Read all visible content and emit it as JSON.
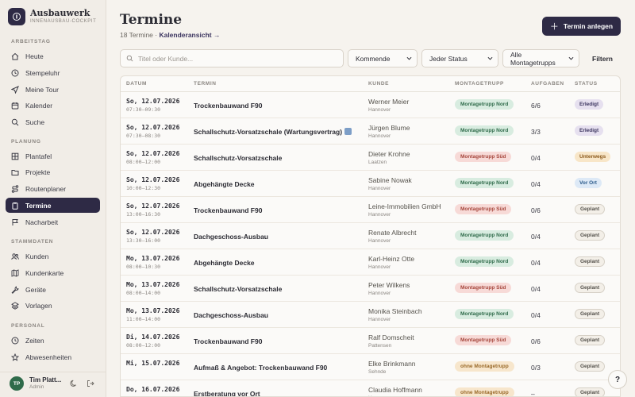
{
  "brand": {
    "name": "Ausbauwerk",
    "subtitle": "INNENAUSBAU-COCKPIT"
  },
  "sidebar": {
    "sections": [
      {
        "label": "ARBEITSTAG"
      },
      {
        "label": "PLANUNG"
      },
      {
        "label": "STAMMDATEN"
      },
      {
        "label": "PERSONAL"
      }
    ],
    "items": [
      {
        "label": "Heute",
        "icon": "home-icon"
      },
      {
        "label": "Stempeluhr",
        "icon": "clock-icon"
      },
      {
        "label": "Meine Tour",
        "icon": "navigation-icon"
      },
      {
        "label": "Kalender",
        "icon": "calendar-icon"
      },
      {
        "label": "Suche",
        "icon": "search-icon"
      },
      {
        "label": "Plantafel",
        "icon": "grid-icon"
      },
      {
        "label": "Projekte",
        "icon": "folder-icon"
      },
      {
        "label": "Routenplaner",
        "icon": "route-icon"
      },
      {
        "label": "Termine",
        "icon": "clipboard-icon",
        "active": true
      },
      {
        "label": "Nacharbeit",
        "icon": "flag-icon"
      },
      {
        "label": "Kunden",
        "icon": "users-icon"
      },
      {
        "label": "Kundenkarte",
        "icon": "map-icon"
      },
      {
        "label": "Geräte",
        "icon": "wrench-icon"
      },
      {
        "label": "Vorlagen",
        "icon": "layers-icon"
      },
      {
        "label": "Zeiten",
        "icon": "clock-icon"
      },
      {
        "label": "Abwesenheiten",
        "icon": "star-icon"
      }
    ],
    "user": {
      "initials": "TP",
      "name": "Tim Platt...",
      "role": "Admin"
    }
  },
  "header": {
    "title": "Termine",
    "count_text": "18 Termine · ",
    "calendar_link": "Kalenderansicht →",
    "new_button": "Termin anlegen"
  },
  "filters": {
    "search_placeholder": "Titel oder Kunde...",
    "period": "Kommende",
    "status": "Jeder Status",
    "team": "Alle Montagetrupps",
    "filter_button": "Filtern"
  },
  "table": {
    "columns": [
      "DATUM",
      "TERMIN",
      "KUNDE",
      "MONTAGETRUPP",
      "AUFGABEN",
      "STATUS"
    ],
    "rows": [
      {
        "date": "So, 12.07.2026",
        "time": "07:30–09:30",
        "title": "Trockenbauwand F90",
        "customer": "Werner Meier",
        "city": "Hannover",
        "team": "Montagetrupp Nord",
        "team_kind": "nord",
        "tasks": "6/6",
        "status": "Erledigt",
        "status_kind": "erledigt"
      },
      {
        "date": "So, 12.07.2026",
        "time": "07:30–08:30",
        "title": "Schallschutz-Vorsatzschale (Wartungsvertrag)",
        "contract_icon": true,
        "customer": "Jürgen Blume",
        "city": "Hannover",
        "team": "Montagetrupp Nord",
        "team_kind": "nord",
        "tasks": "3/3",
        "status": "Erledigt",
        "status_kind": "erledigt"
      },
      {
        "date": "So, 12.07.2026",
        "time": "08:00–12:00",
        "title": "Schallschutz-Vorsatzschale",
        "customer": "Dieter Krohne",
        "city": "Laatzen",
        "team": "Montagetrupp Süd",
        "team_kind": "sued",
        "tasks": "0/4",
        "status": "Unterwegs",
        "status_kind": "unterwegs"
      },
      {
        "date": "So, 12.07.2026",
        "time": "10:00–12:30",
        "title": "Abgehängte Decke",
        "customer": "Sabine Nowak",
        "city": "Hannover",
        "team": "Montagetrupp Nord",
        "team_kind": "nord",
        "tasks": "0/4",
        "status": "Vor Ort",
        "status_kind": "vorort"
      },
      {
        "date": "So, 12.07.2026",
        "time": "13:00–16:30",
        "title": "Trockenbauwand F90",
        "customer": "Leine-Immobilien GmbH",
        "city": "Hannover",
        "team": "Montagetrupp Süd",
        "team_kind": "sued",
        "tasks": "0/6",
        "status": "Geplant",
        "status_kind": "geplant"
      },
      {
        "date": "So, 12.07.2026",
        "time": "13:30–16:00",
        "title": "Dachgeschoss-Ausbau",
        "customer": "Renate Albrecht",
        "city": "Hannover",
        "team": "Montagetrupp Nord",
        "team_kind": "nord",
        "tasks": "0/4",
        "status": "Geplant",
        "status_kind": "geplant"
      },
      {
        "date": "Mo, 13.07.2026",
        "time": "08:00–10:30",
        "title": "Abgehängte Decke",
        "customer": "Karl-Heinz Otte",
        "city": "Hannover",
        "team": "Montagetrupp Nord",
        "team_kind": "nord",
        "tasks": "0/4",
        "status": "Geplant",
        "status_kind": "geplant"
      },
      {
        "date": "Mo, 13.07.2026",
        "time": "08:00–14:00",
        "title": "Schallschutz-Vorsatzschale",
        "customer": "Peter Wilkens",
        "city": "Hannover",
        "team": "Montagetrupp Süd",
        "team_kind": "sued",
        "tasks": "0/4",
        "status": "Geplant",
        "status_kind": "geplant"
      },
      {
        "date": "Mo, 13.07.2026",
        "time": "11:00–14:00",
        "title": "Dachgeschoss-Ausbau",
        "customer": "Monika Steinbach",
        "city": "Hannover",
        "team": "Montagetrupp Nord",
        "team_kind": "nord",
        "tasks": "0/4",
        "status": "Geplant",
        "status_kind": "geplant"
      },
      {
        "date": "Di, 14.07.2026",
        "time": "08:00–12:00",
        "title": "Trockenbauwand F90",
        "customer": "Ralf Domscheit",
        "city": "Pattensen",
        "team": "Montagetrupp Süd",
        "team_kind": "sued",
        "tasks": "0/6",
        "status": "Geplant",
        "status_kind": "geplant"
      },
      {
        "date": "Mi, 15.07.2026",
        "time": "",
        "title": "Aufmaß & Angebot: Trockenbauwand F90",
        "customer": "Elke Brinkmann",
        "city": "Sehnde",
        "team": "ohne Montagetrupp",
        "team_kind": "none",
        "tasks": "0/3",
        "status": "Geplant",
        "status_kind": "geplant"
      },
      {
        "date": "Do, 16.07.2026",
        "time": "",
        "title": "Erstberatung vor Ort",
        "customer": "Claudia Hoffmann",
        "city": "Hannover",
        "team": "ohne Montagetrupp",
        "team_kind": "none",
        "tasks": "–",
        "status": "Geplant",
        "status_kind": "geplant"
      }
    ]
  },
  "help_button": "?"
}
